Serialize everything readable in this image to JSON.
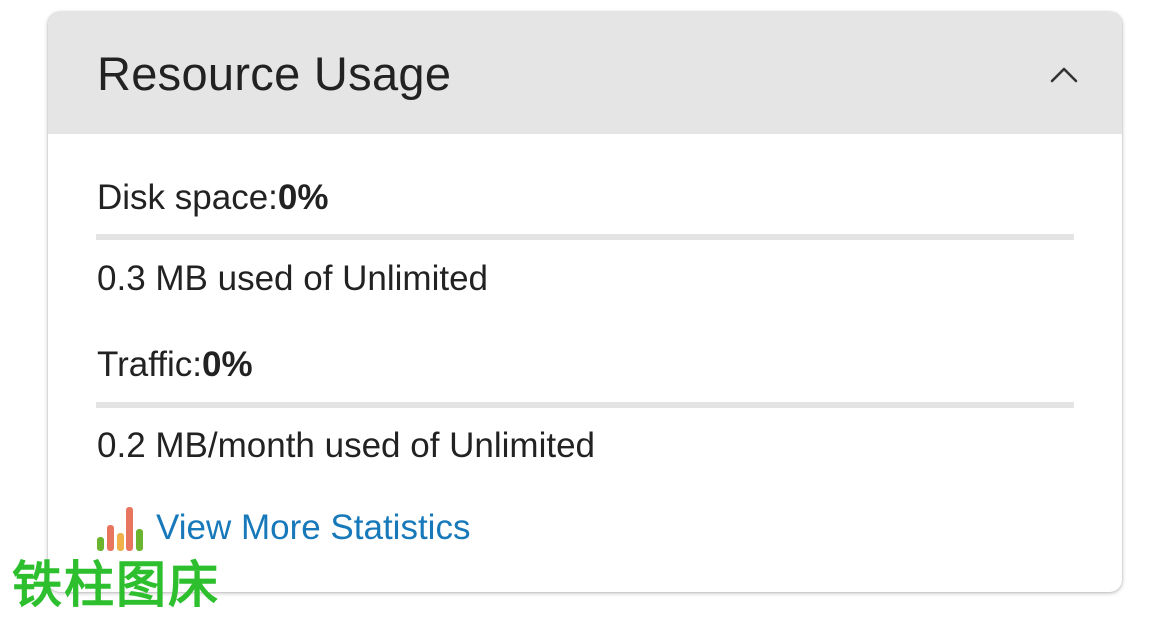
{
  "card": {
    "title": "Resource Usage",
    "toggle_icon": "chevron-up-icon"
  },
  "metrics": [
    {
      "label": "Disk space:",
      "percent": "0%",
      "percent_value": 0,
      "detail": "0.3 MB used of Unlimited"
    },
    {
      "label": "Traffic:",
      "percent": "0%",
      "percent_value": 0,
      "detail": "0.2 MB/month used of Unlimited"
    }
  ],
  "stats_link": {
    "label": "View More Statistics",
    "icon": "bar-chart-icon"
  },
  "watermark": {
    "text": "铁柱图床"
  },
  "colors": {
    "header_bg": "#e5e5e5",
    "link": "#1779ba",
    "track": "#e4e4e4",
    "watermark": "#2dbf2d"
  }
}
